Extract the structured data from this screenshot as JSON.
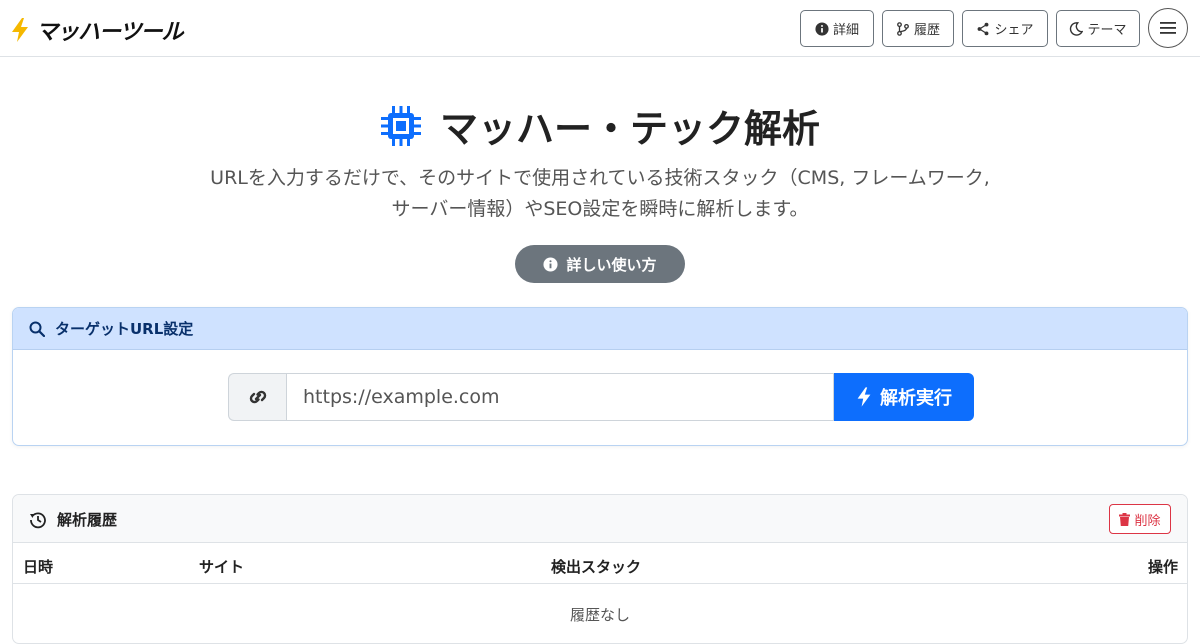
{
  "brand": {
    "name": "マッハーツール"
  },
  "header": {
    "buttons": [
      {
        "label": "詳細",
        "icon": "info-circle-icon"
      },
      {
        "label": "履歴",
        "icon": "branch-icon"
      },
      {
        "label": "シェア",
        "icon": "share-icon"
      },
      {
        "label": "テーマ",
        "icon": "moon-icon"
      }
    ],
    "menu_icon": "hamburger-icon"
  },
  "hero": {
    "title": "マッハー・テック解析",
    "icon": "cpu-chip-icon",
    "description": "URLを入力するだけで、そのサイトで使用されている技術スタック（CMS, フレームワーク, サーバー情報）やSEO設定を瞬時に解析します。",
    "help_button": "詳しい使い方"
  },
  "target": {
    "title": "ターゲットURL設定",
    "placeholder": "https://example.com",
    "submit": "解析実行"
  },
  "history": {
    "title": "解析履歴",
    "delete": "削除",
    "columns": [
      "日時",
      "サイト",
      "検出スタック",
      "操作"
    ],
    "empty": "履歴なし"
  },
  "colors": {
    "primary": "#0d6efd",
    "danger": "#dc3545",
    "secondary": "#6c757d",
    "card_header": "#cfe2ff"
  }
}
